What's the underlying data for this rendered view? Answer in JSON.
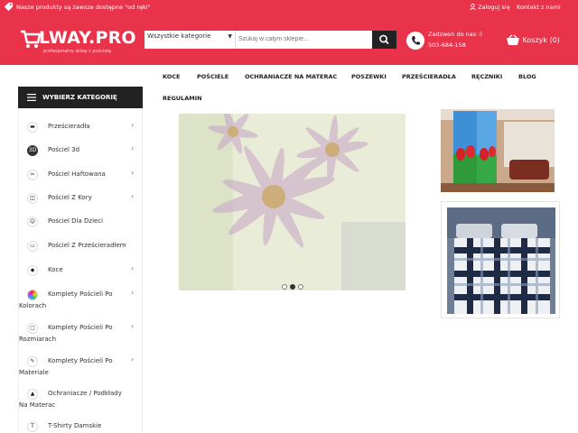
{
  "topbar": {
    "note": "Nasze produkty są zawsze dostępne \"od ręki\"",
    "login": "Zaloguj się",
    "contact": "Kontakt z nami"
  },
  "header": {
    "logo_text": "LWAY.PRO",
    "logo_tagline": "profesjonalny sklep z pościelą",
    "category_select": "Wszystkie kategorie",
    "search_placeholder": "Szukaj w całym sklepie...",
    "phone_label": "Zadzwoń do nas :)",
    "phone_number": "503-684-158",
    "cart_label": "Koszyk",
    "cart_count": "(0)"
  },
  "nav": {
    "items": [
      "KOCE",
      "POŚCIELE",
      "OCHRANIACZE NA MATERAC",
      "POSZEWKI",
      "PRZEŚCIERADŁA",
      "RĘCZNIKI",
      "BLOG",
      "REGULAMIN"
    ]
  },
  "sidebar": {
    "title": "WYBIERZ KATEGORIĘ",
    "items": [
      {
        "label": "Prześcieradła",
        "icon": "sheet-icon",
        "chevron": "›"
      },
      {
        "label": "Pościel 3d",
        "icon": "3d-icon",
        "chevron": "›"
      },
      {
        "label": "Pościel Haftowana",
        "icon": "embroidery-icon",
        "chevron": "›"
      },
      {
        "label": "Pościel Z Kory",
        "icon": "bark-icon",
        "chevron": "›"
      },
      {
        "label": "Pościel Dla Dzieci",
        "icon": "kids-icon",
        "chevron": ""
      },
      {
        "label": "Pościel Z Prześcieradłem",
        "icon": "bed-set-icon",
        "chevron": ""
      },
      {
        "label": "Koce",
        "icon": "blanket-icon",
        "chevron": "›"
      },
      {
        "label": "Komplety Pościeli Po",
        "label2": "Kolorach",
        "icon": "colors-icon",
        "chevron": "›"
      },
      {
        "label": "Komplety Pościeli Po",
        "label2": "Rozmiarach",
        "icon": "sizes-icon",
        "chevron": "›"
      },
      {
        "label": "Komplety Pościeli Po",
        "label2": "Materiale",
        "icon": "material-icon",
        "chevron": "›"
      },
      {
        "label": "Ochraniacze / Podkłady",
        "label2": "Na Materac",
        "icon": "mattress-icon",
        "chevron": ""
      },
      {
        "label": "T-Shirty Damskie",
        "icon": "tshirt-icon",
        "chevron": ""
      }
    ]
  },
  "slider": {
    "slides": 3,
    "active": 2
  },
  "colors": {
    "brand": "#e8334a",
    "dark": "#222222"
  }
}
